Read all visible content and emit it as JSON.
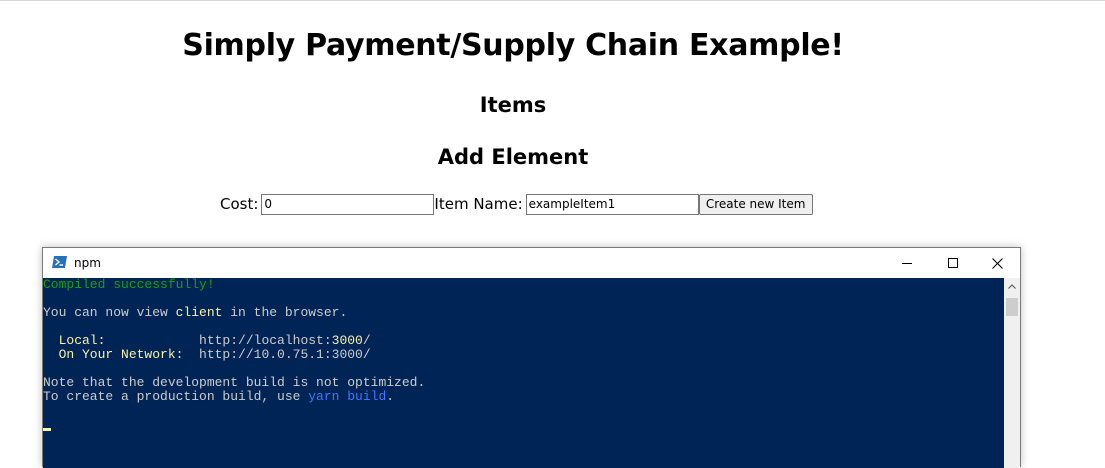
{
  "page": {
    "title": "Simply Payment/Supply Chain Example!",
    "items_heading": "Items",
    "add_heading": "Add Element",
    "form": {
      "cost_label": "Cost:",
      "cost_value": "0",
      "name_label": "Item Name:",
      "name_value": "exampleItem1",
      "submit_label": "Create new Item"
    }
  },
  "terminal": {
    "title": "npm",
    "compiled": "Compiled successfully!",
    "view_prefix": "You can now view ",
    "view_app": "client",
    "view_suffix": " in the browser.",
    "local_label": "  Local:            ",
    "local_url_prefix": "http://localhost:",
    "local_port": "3000",
    "local_url_suffix": "/",
    "network_label": "  On Your Network:  ",
    "network_url": "http://10.0.75.1:3000/",
    "note_line1": "Note that the development build is not optimized.",
    "note_line2_prefix": "To create a production build, use ",
    "note_cmd": "yarn build",
    "note_line2_suffix": "."
  },
  "colors": {
    "console_bg": "#012456",
    "console_text": "#cccccc",
    "success_green": "#13a10e",
    "highlight_yellow": "#f9f1a5",
    "command_blue": "#3b78ff"
  },
  "icons": {
    "terminal": "powershell-icon",
    "minimize": "minimize-icon",
    "maximize": "maximize-icon",
    "close": "close-icon",
    "scroll_up": "chevron-up-icon"
  }
}
